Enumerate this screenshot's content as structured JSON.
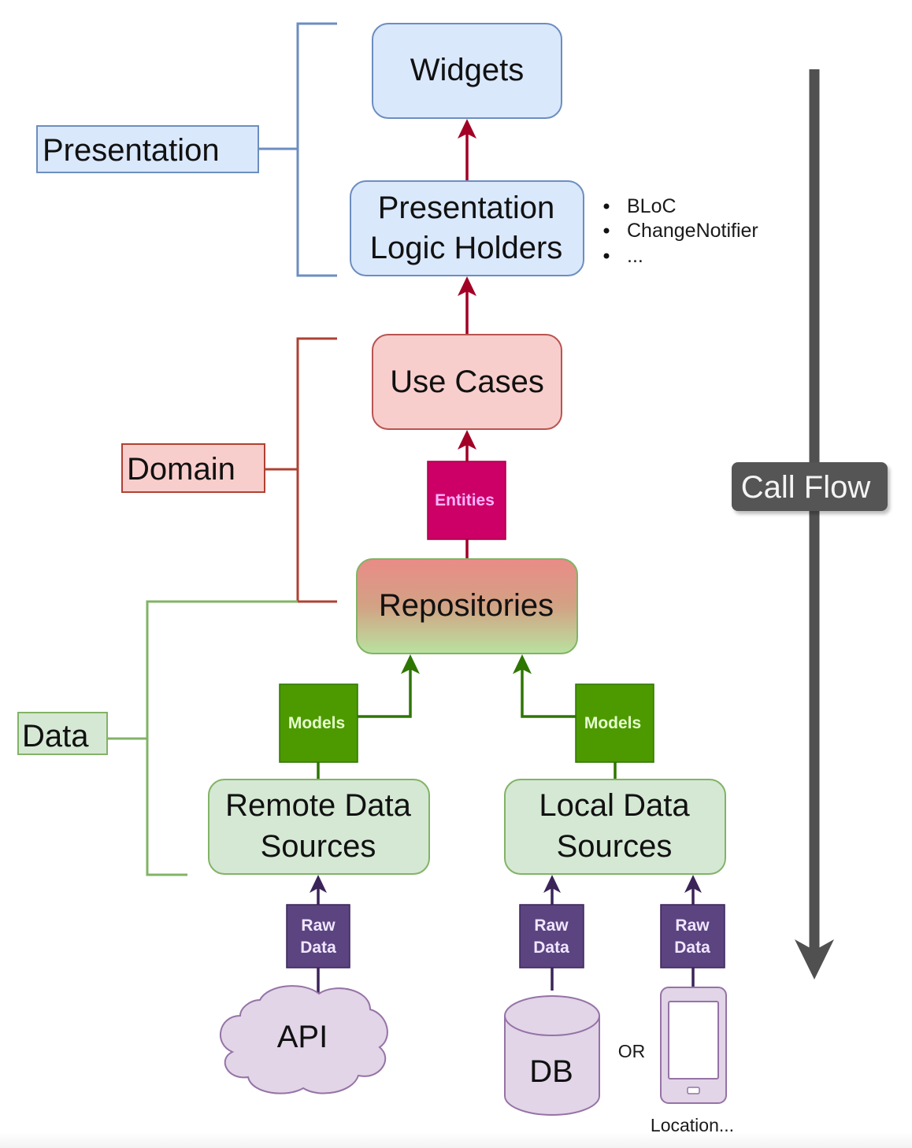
{
  "layers": {
    "presentation": {
      "label": "Presentation",
      "color": "#6c8ebf",
      "fill": "#dae8fc"
    },
    "domain": {
      "label": "Domain",
      "color": "#ae4132",
      "fill": "#f8cecc"
    },
    "data": {
      "label": "Data",
      "color": "#82b366",
      "fill": "#d5e8d4"
    }
  },
  "nodes": {
    "widgets": {
      "label": "Widgets"
    },
    "logic_holders": {
      "line1": "Presentation",
      "line2": "Logic Holders"
    },
    "use_cases": {
      "label": "Use Cases"
    },
    "repositories": {
      "label": "Repositories"
    },
    "remote_sources": {
      "line1": "Remote Data",
      "line2": "Sources"
    },
    "local_sources": {
      "line1": "Local Data",
      "line2": "Sources"
    },
    "api": {
      "label": "API"
    },
    "db": {
      "label": "DB"
    },
    "device_caption": "Location...",
    "or_label": "OR"
  },
  "logic_holder_examples": [
    "BLoC",
    "ChangeNotifier",
    "..."
  ],
  "connectors": {
    "entities": {
      "label": "Entities",
      "fill": "#cc0066",
      "text": "#ffb3ff"
    },
    "models_left": {
      "label": "Models",
      "fill": "#4d9900",
      "text": "#e6ffcc"
    },
    "models_right": {
      "label": "Models",
      "fill": "#4d9900",
      "text": "#e6ffcc"
    },
    "raw_api": {
      "line1": "Raw",
      "line2": "Data"
    },
    "raw_db": {
      "line1": "Raw",
      "line2": "Data"
    },
    "raw_device": {
      "line1": "Raw",
      "line2": "Data"
    }
  },
  "call_flow": {
    "label": "Call Flow",
    "color": "#505050"
  },
  "colors": {
    "domain_arrow": "#a20025",
    "data_arrow": "#2d7600",
    "raw_arrow": "#3a2458",
    "raw_fill": "#5c4480",
    "source_fill": "#e1d5e7",
    "source_stroke": "#9673a6"
  }
}
